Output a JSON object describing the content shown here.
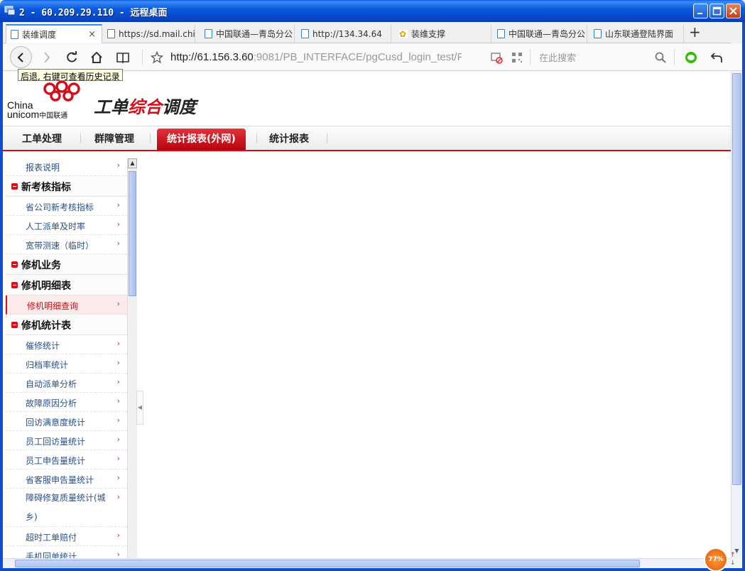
{
  "window": {
    "title": "2 - 60.209.29.110 - 远程桌面"
  },
  "tabs": [
    {
      "label": "装维调度",
      "close": "×"
    },
    {
      "label": "https://sd.mail.chi"
    },
    {
      "label": "中国联通—青岛分公"
    },
    {
      "label": "http://134.34.64"
    },
    {
      "label": "装维支撑"
    },
    {
      "label": "中国联通—青岛分公"
    },
    {
      "label": "山东联通登陆界面"
    }
  ],
  "new_tab": "+",
  "address": {
    "url_host": "http://61.156.3.60",
    "url_rest": ":9081/PB_INTERFACE/pgCusd_login_test/PE",
    "search_placeholder": "在此搜索"
  },
  "tooltip": "后退, 右键可查看历史记录",
  "logo": {
    "china": "China",
    "unicom": "unicom",
    "unicom_cn": "中国联通",
    "brand_a": "工单",
    "brand_b": "综合",
    "brand_c": "调度"
  },
  "menu": [
    "工单处理",
    "群障管理",
    "统计报表(外网)",
    "统计报表"
  ],
  "sidebar": {
    "report_desc": "报表说明",
    "group1": "新考核指标",
    "g1_items": [
      "省公司新考核指标",
      "人工派单及时率",
      "宽带测速（临时）"
    ],
    "group2": "修机业务",
    "group3": "修机明细表",
    "g3_items": [
      "修机明细查询"
    ],
    "group4": "修机统计表",
    "g4_items": [
      "催修统计",
      "归档率统计",
      "自动派单分析",
      "故障原因分析",
      "回访满意度统计",
      "员工回访量统计",
      "员工申告量统计",
      "省客服申告量统计",
      "障碍修复质量统计(城乡)",
      "超时工单赔付",
      "手机回单统计"
    ],
    "chevron": "›"
  },
  "tray": {
    "percent": "77%"
  }
}
